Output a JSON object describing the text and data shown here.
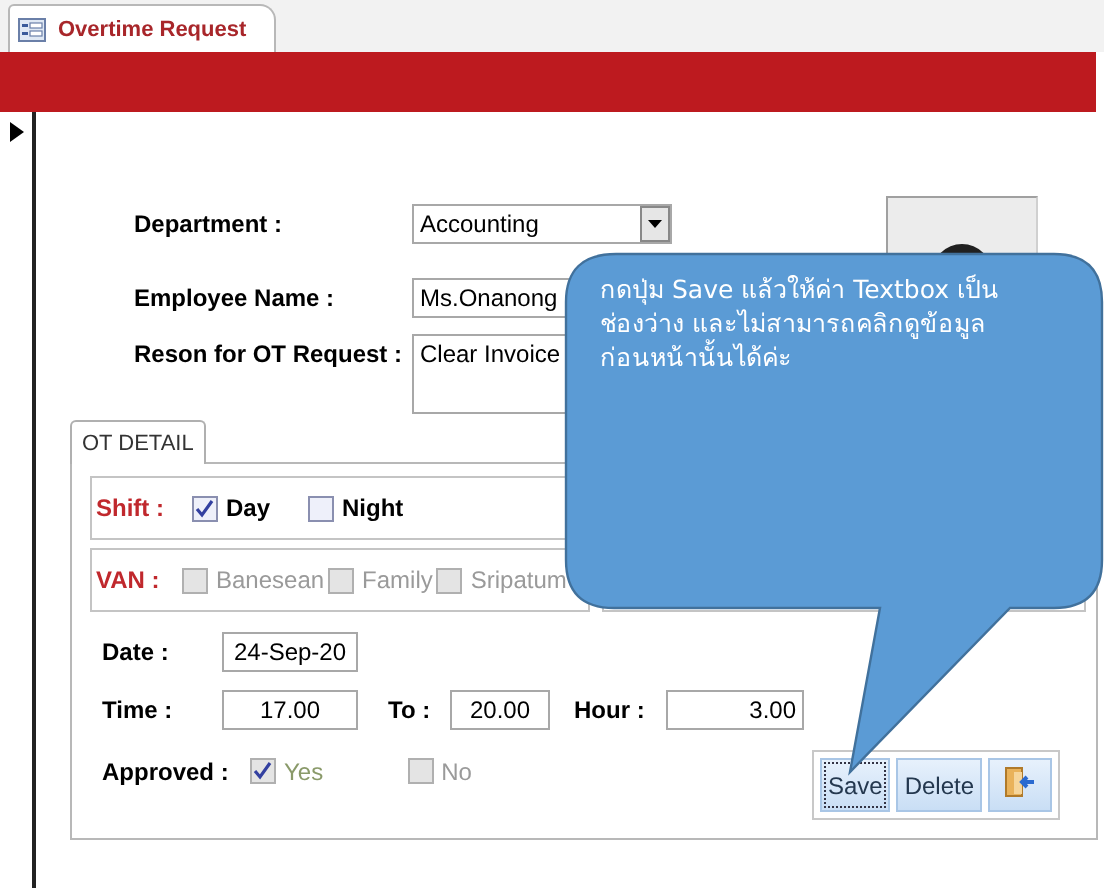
{
  "document_tab": {
    "title": "Overtime Request",
    "selected": true
  },
  "fields": [
    {
      "kind": "dropdown",
      "label": "Department :",
      "value": "Accounting"
    },
    {
      "kind": "text",
      "label": "Employee Name :",
      "value": "Ms.Onanong"
    },
    {
      "kind": "memo",
      "label": "Reson for OT Request :",
      "value": "Clear Invoice"
    }
  ],
  "detail_tab": {
    "label": "OT DETAIL",
    "selected": true
  },
  "shift": {
    "label": "Shift :",
    "options": [
      {
        "label": "Day",
        "checked": true,
        "disabled": false
      },
      {
        "label": "Night",
        "checked": false,
        "disabled": false
      }
    ]
  },
  "van": {
    "label": "VAN :",
    "options": [
      {
        "label": "Banesean",
        "checked": false,
        "disabled": true
      },
      {
        "label": "Family",
        "checked": false,
        "disabled": true
      },
      {
        "label": "Sripatum",
        "checked": false,
        "disabled": true
      }
    ]
  },
  "date": {
    "label": "Date :",
    "value": "24-Sep-20"
  },
  "time": {
    "label": "Time :",
    "value": "17.00",
    "to_label": "To :",
    "to_value": "20.00",
    "hour_label": "Hour :",
    "hour_value": "3.00"
  },
  "approved": {
    "label": "Approved :",
    "options": [
      {
        "label": "Yes",
        "checked": true,
        "disabled": true
      },
      {
        "label": "No",
        "checked": false,
        "disabled": true
      }
    ]
  },
  "buttons": [
    {
      "kind": "text",
      "label": "Save",
      "focused": true
    },
    {
      "kind": "text",
      "label": "Delete",
      "focused": false
    },
    {
      "kind": "exit",
      "focused": false
    }
  ],
  "callout": {
    "lines": [
      "กดปุ่ม Save แล้วให้ค่า Textbox เป็น",
      "ช่องว่าง และไม่สามารถคลิกดูข้อมูล",
      "ก่อนหน้านั้นได้ค่ะ"
    ]
  }
}
